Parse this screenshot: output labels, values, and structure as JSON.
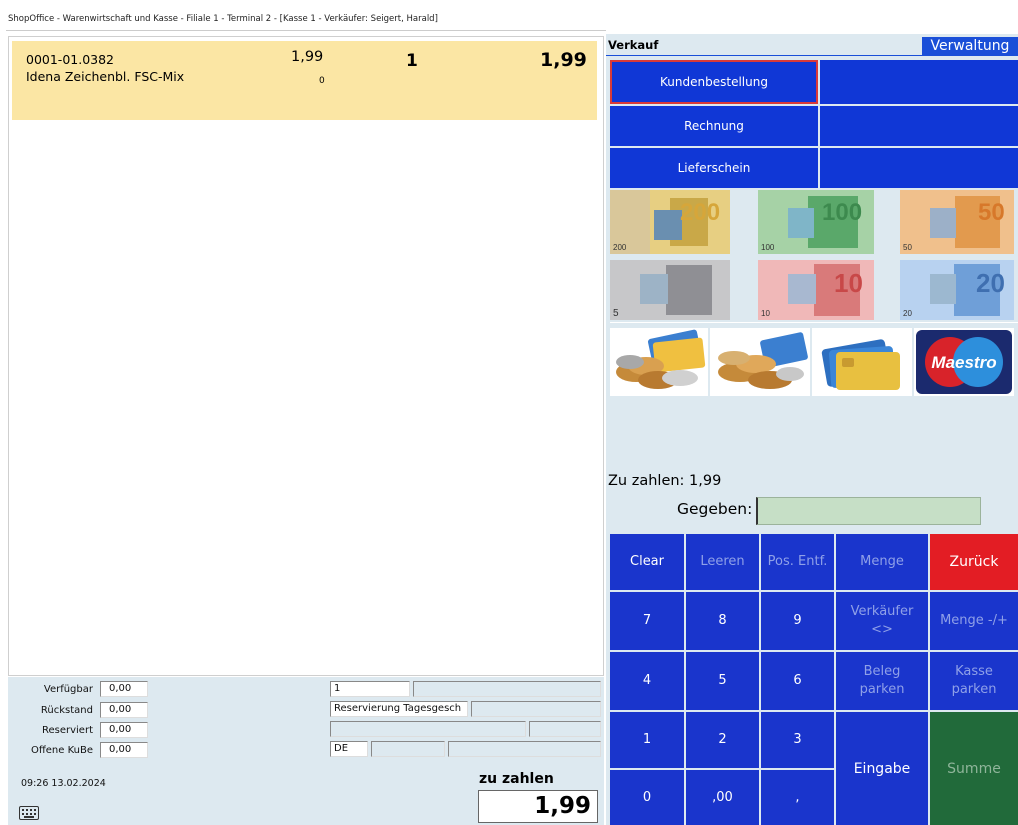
{
  "window": {
    "title": "ShopOffice - Warenwirtschaft und Kasse - Filiale 1 - Terminal 2 - [Kasse 1  -  Verkäufer: Seigert, Harald]"
  },
  "positions": [
    {
      "article": "0001-01.0382",
      "name": "Idena Zeichenbl. FSC-Mix",
      "price": "1,99",
      "sub": "0",
      "qty": "1",
      "total": "1,99"
    }
  ],
  "info": {
    "verfuegbar_label": "Verfügbar",
    "verfuegbar": "0,00",
    "rueckstand_label": "Rückstand",
    "rueckstand": "0,00",
    "reserviert_label": "Reserviert",
    "reserviert": "0,00",
    "offene_label": "Offene KuBe",
    "offene": "0,00",
    "field1": "1",
    "field2": "Reservierung Tagesgesch",
    "field3": "DE",
    "datetime": "09:26 13.02.2024",
    "zu_zahlen_label": "zu zahlen",
    "zu_zahlen": "1,99"
  },
  "panel": {
    "verkauf": "Verkauf",
    "verwaltung": "Verwaltung",
    "btn_kundenbestellung": "Kundenbestellung",
    "btn_rechnung": "Rechnung",
    "btn_lieferschein": "Lieferschein",
    "zahlen_label": "Zu zahlen: 1,99",
    "gegeben_label": "Gegeben:"
  },
  "notes": [
    {
      "value": "200",
      "label": "200 EURO",
      "color": "#d9b85a",
      "icon": "euro-200-note"
    },
    {
      "value": "100",
      "label": "100 EURO",
      "color": "#7fbf8c",
      "icon": "euro-100-note"
    },
    {
      "value": "50",
      "label": "50 EURO",
      "color": "#e29a4e",
      "icon": "euro-50-note"
    },
    {
      "value": "5",
      "label": "5 EURO",
      "color": "#9a9aa0",
      "icon": "euro-5-note"
    },
    {
      "value": "10",
      "label": "10 EURO",
      "color": "#e08080",
      "icon": "euro-10-note"
    },
    {
      "value": "20",
      "label": "20 EURO",
      "color": "#6f9fd8",
      "icon": "euro-20-note"
    }
  ],
  "payment": {
    "maestro": "Maestro"
  },
  "keypad": {
    "clear": "Clear",
    "leeren": "Leeren",
    "pos_entf": "Pos. Entf.",
    "menge": "Menge",
    "zurueck": "Zurück",
    "k7": "7",
    "k8": "8",
    "k9": "9",
    "verkaeufer": "Verkäufer\n<>",
    "menge_pm": "Menge -/+",
    "k4": "4",
    "k5": "5",
    "k6": "6",
    "beleg": "Beleg\nparken",
    "kasse": "Kasse\nparken",
    "k1": "1",
    "k2": "2",
    "k3": "3",
    "eingabe": "Eingabe",
    "summe": "Summe",
    "k0": "0",
    "k00": ",00",
    "kcomma": ","
  }
}
